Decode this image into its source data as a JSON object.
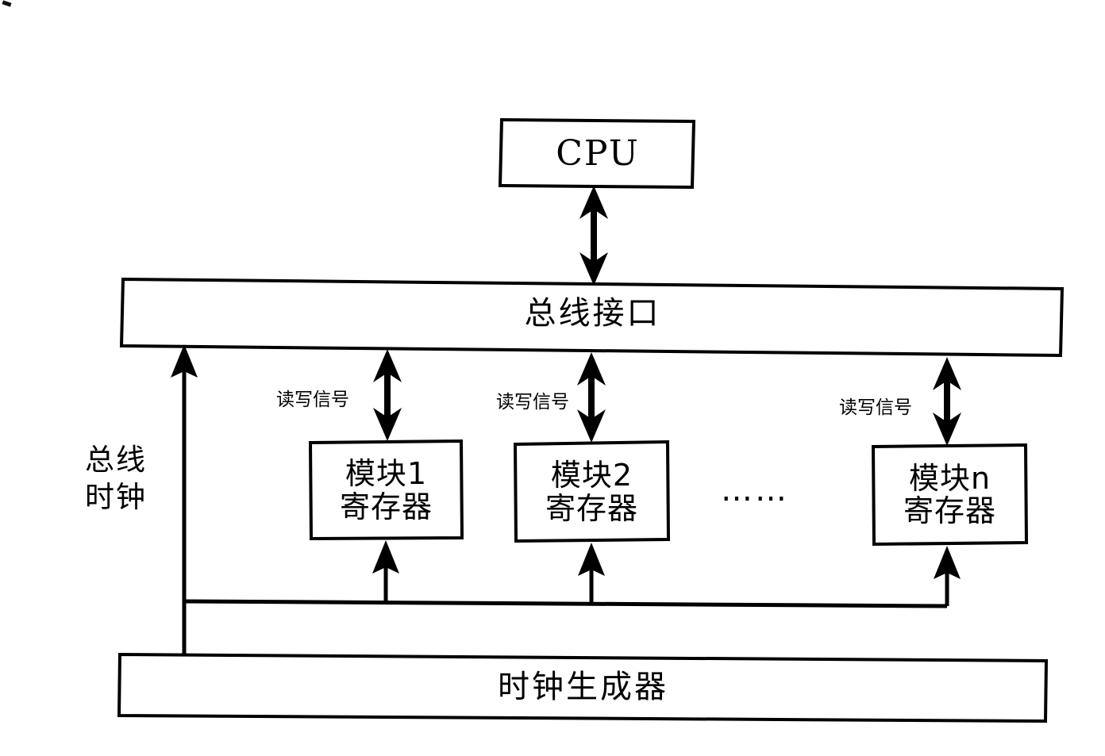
{
  "diagram": {
    "title_text": "",
    "type": "block-diagram",
    "language": "zh-CN",
    "line_color": "#000000",
    "background_color": "#ffffff",
    "nodes": {
      "cpu": {
        "label": "CPU"
      },
      "bus_interface": {
        "label": "总线接口"
      },
      "module1": {
        "label_line1": "模块1",
        "label_line2": "寄存器"
      },
      "module2": {
        "label_line1": "模块2",
        "label_line2": "寄存器"
      },
      "modulen": {
        "label_line1": "模块n",
        "label_line2": "寄存器"
      },
      "clock_generator": {
        "label": "时钟生成器"
      }
    },
    "edge_labels": {
      "rw_signal_1": "读写信号",
      "rw_signal_2": "读写信号",
      "rw_signal_n": "读写信号",
      "bus_clock_line1": "总线",
      "bus_clock_line2": "时钟"
    },
    "ellipsis": "……"
  }
}
